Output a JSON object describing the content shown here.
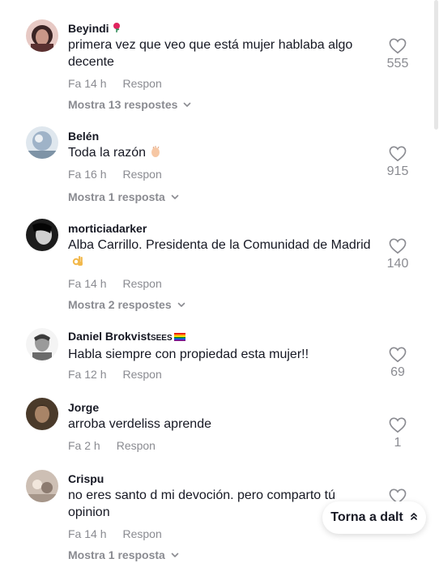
{
  "comments": [
    {
      "username": "Beyindi",
      "badge": "rose-emoji",
      "text": "primera vez que veo que está mujer hablaba algo decente",
      "time": "Fa 14 h",
      "reply_label": "Respon",
      "replies_label": "Mostra 13 respostes",
      "likes": "555"
    },
    {
      "username": "Belén",
      "text": "Toda la razón",
      "text_emoji": "clapping-hands-emoji",
      "time": "Fa 16 h",
      "reply_label": "Respon",
      "replies_label": "Mostra 1 resposta",
      "likes": "915"
    },
    {
      "username": "morticiadarker",
      "text": "Alba Carrillo. Presidenta de la Comunidad de Madrid",
      "text_emoji": "ok-hand-emoji",
      "time": "Fa 14 h",
      "reply_label": "Respon",
      "replies_label": "Mostra 2 respostes",
      "likes": "140"
    },
    {
      "username": "Daniel Brokvist",
      "username_suffix": "SEES",
      "badge": "rainbow-flag-emoji",
      "text": "Habla siempre con propiedad esta mujer!!",
      "time": "Fa 12 h",
      "reply_label": "Respon",
      "likes": "69"
    },
    {
      "username": "Jorge",
      "text": "arroba verdeliss aprende",
      "time": "Fa 2 h",
      "reply_label": "Respon",
      "likes": "1"
    },
    {
      "username": "Crispu",
      "text": "no eres santo d mi devoción. pero comparto tú opinion",
      "time": "Fa 14 h",
      "reply_label": "Respon",
      "replies_label": "Mostra 1 resposta"
    }
  ],
  "back_to_top": {
    "label": "Torna a dalt",
    "icon": "double-chevron-up-icon"
  },
  "colors": {
    "text": "#161823",
    "muted": "#8a8b91"
  }
}
